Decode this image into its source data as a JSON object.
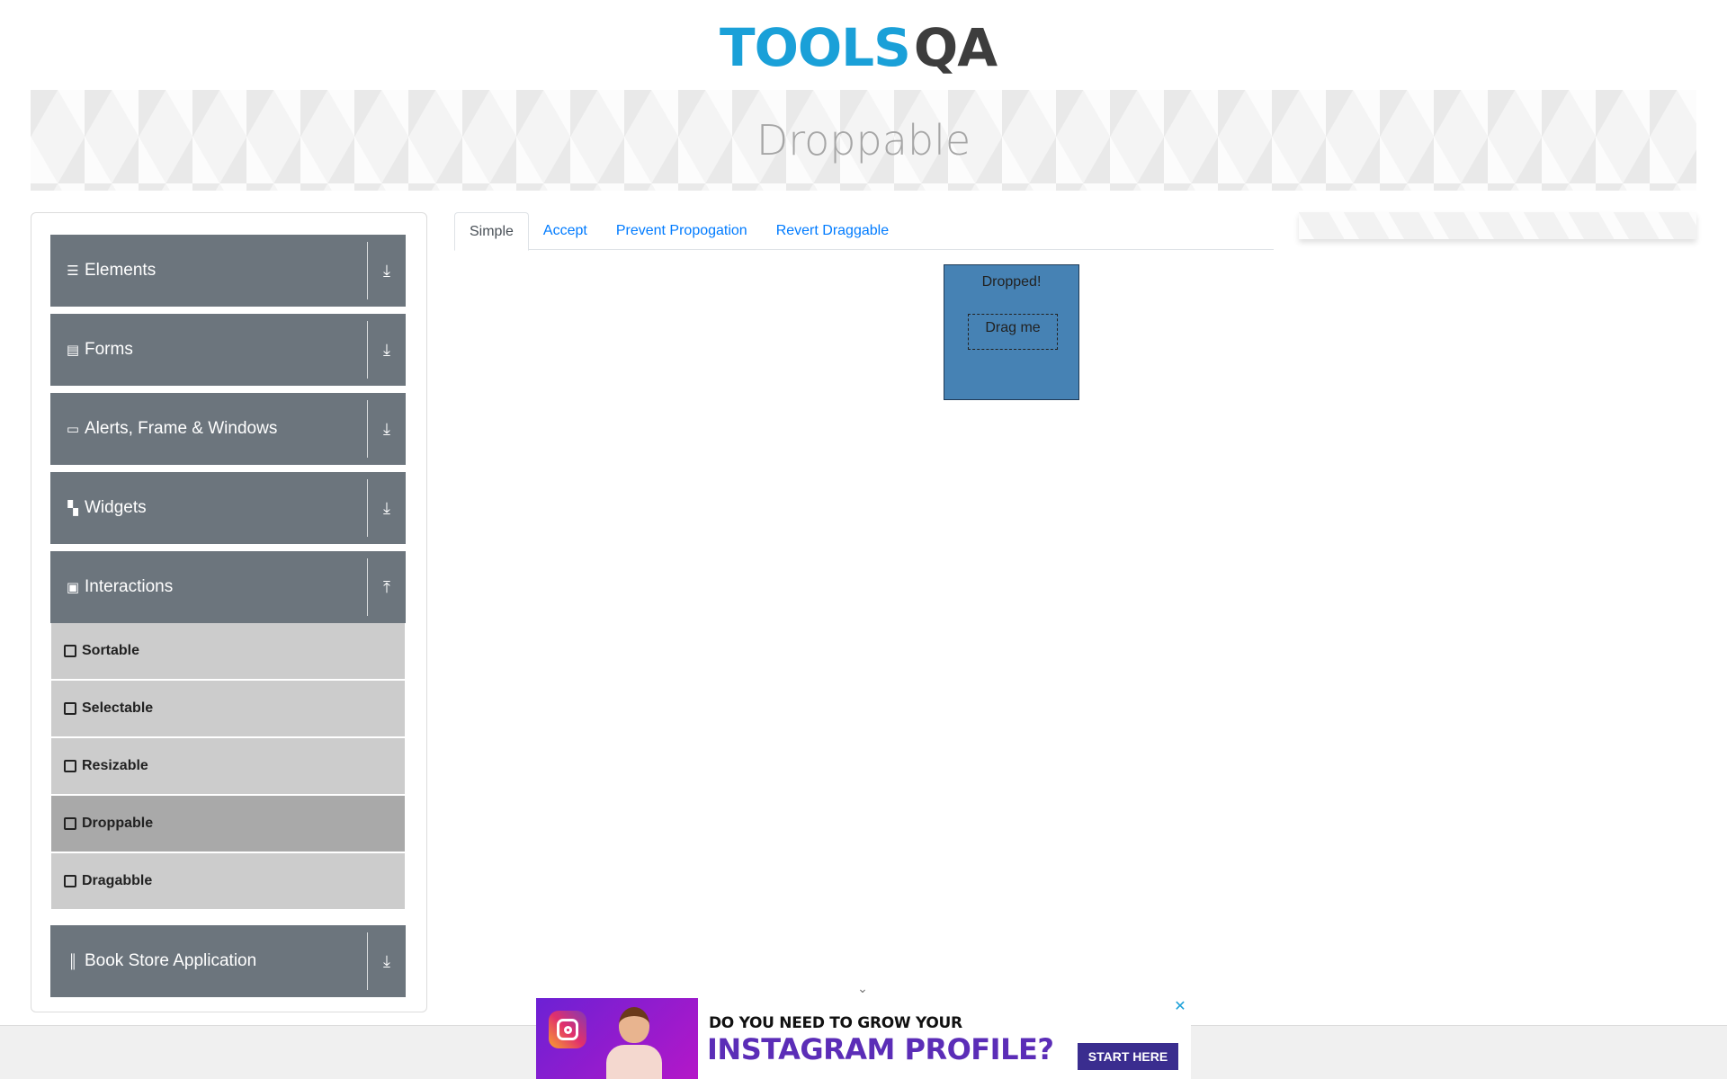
{
  "header": {
    "logo_tools": "TOOLS",
    "logo_q": "Q",
    "logo_a": "A"
  },
  "page_title": "Droppable",
  "sidebar": {
    "groups": [
      {
        "label": "Elements",
        "icon": "hamburger-icon",
        "toggle_icon": "download-arrow-icon"
      },
      {
        "label": "Forms",
        "icon": "document-icon",
        "toggle_icon": "download-arrow-icon"
      },
      {
        "label": "Alerts, Frame & Windows",
        "icon": "window-icon",
        "toggle_icon": "download-arrow-icon"
      },
      {
        "label": "Widgets",
        "icon": "widgets-icon",
        "toggle_icon": "download-arrow-icon"
      },
      {
        "label": "Interactions",
        "icon": "interactions-icon",
        "toggle_icon": "upload-arrow-icon"
      },
      {
        "label": "Book Store Application",
        "icon": "books-icon",
        "toggle_icon": "download-arrow-icon"
      }
    ],
    "interaction_items": [
      {
        "label": "Sortable",
        "active": false
      },
      {
        "label": "Selectable",
        "active": false
      },
      {
        "label": "Resizable",
        "active": false
      },
      {
        "label": "Droppable",
        "active": true
      },
      {
        "label": "Dragabble",
        "active": false
      }
    ]
  },
  "tabs": [
    {
      "label": "Simple",
      "active": true
    },
    {
      "label": "Accept",
      "active": false
    },
    {
      "label": "Prevent Propogation",
      "active": false
    },
    {
      "label": "Revert Draggable",
      "active": false
    }
  ],
  "droppable": {
    "drop_text": "Dropped!",
    "drag_text": "Drag me",
    "drop_color": "#4682b4"
  },
  "ad": {
    "line1": "DO YOU NEED TO GROW YOUR",
    "line2": "INSTAGRAM PROFILE?",
    "cta": "START HERE",
    "close": "✕"
  },
  "colors": {
    "brand_blue": "#1aa0d8",
    "sidebar_header": "#6c757d",
    "tab_link": "#007bff"
  }
}
